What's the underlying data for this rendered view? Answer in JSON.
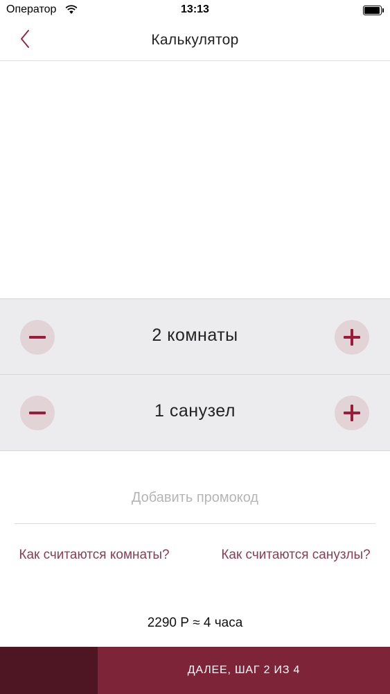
{
  "status_bar": {
    "carrier": "Оператор",
    "time": "13:13",
    "wifi_icon": "wifi-icon",
    "battery_icon": "battery-icon"
  },
  "nav": {
    "title": "Калькулятор",
    "back_icon": "chevron-left-icon"
  },
  "stepper": {
    "rooms_label": "2 комнаты",
    "bathrooms_label": "1 санузел",
    "minus_icon": "minus-icon",
    "plus_icon": "plus-icon"
  },
  "promo": {
    "label": "Добавить промокод"
  },
  "links": {
    "rooms_help": "Как считаются комнаты?",
    "bathrooms_help": "Как считаются санузлы?"
  },
  "summary": {
    "price_text": "2290 Р ≈ 4 часа"
  },
  "footer": {
    "next_label": "ДАЛЕЕ, ШАГ 2 ИЗ 4"
  },
  "colors": {
    "accent": "#9b1b3a",
    "link": "#8e3a52",
    "footer_dark": "#4e1522",
    "footer_button": "#7d2438",
    "stepper_bg": "#ececee",
    "circle_bg": "#e2d4d6"
  }
}
